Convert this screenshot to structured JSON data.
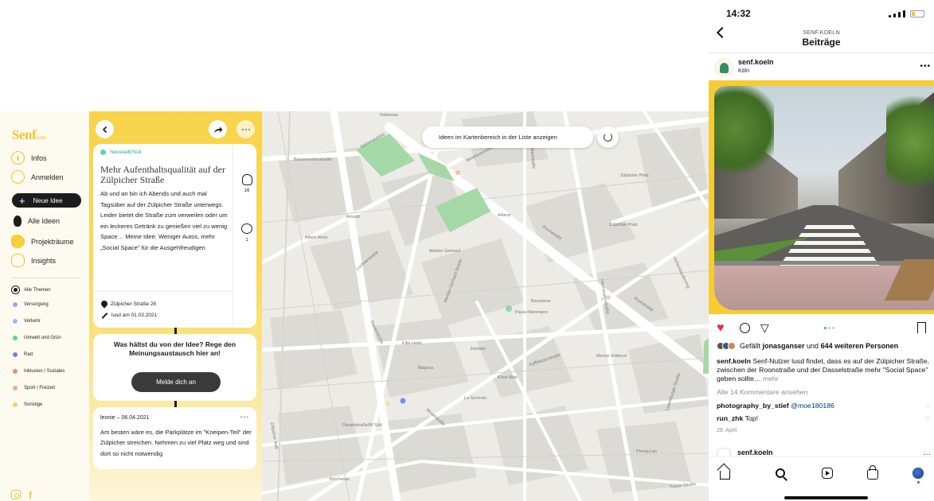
{
  "sidebar": {
    "logo": "Senf",
    "logo_sub": "koeln",
    "nav": [
      {
        "label": "Infos",
        "glyph": "i"
      },
      {
        "label": "Anmelden"
      },
      {
        "label": "Alle Ideen"
      },
      {
        "label": "Projekträume"
      },
      {
        "label": "Insights"
      }
    ],
    "new_idea": "Neue Idee",
    "themes": [
      {
        "label": "Alle Themen"
      },
      {
        "label": "Versorgung",
        "color": "#b69ae6"
      },
      {
        "label": "Verkehr",
        "color": "#8ec6ef"
      },
      {
        "label": "Umwelt und Grün",
        "color": "#63cfab"
      },
      {
        "label": "Rad",
        "color": "#6f85e0"
      },
      {
        "label": "Inklusion / Soziales",
        "color": "#f08a7a"
      },
      {
        "label": "Sport / Freizeit",
        "color": "#f3ae82"
      },
      {
        "label": "Sonstige",
        "color": "#f4d074"
      }
    ],
    "social_f": "f"
  },
  "idea": {
    "district": "Neustadt/Süd",
    "title": "Mehr Aufenthaltsqualität auf der Zülpicher Straße",
    "body": "Ab und an bin ich Abends und auch mal Tagsüber auf der Zülpicher Straße unterwegs. Leider bietet die Straße zum verweilen oder um ein leckeres Getränk zu genießen viel zu wenig Space… Meine Idee: Weniger Autos, mehr „Social Space\" für die Ausgehfreudigen",
    "address": "Zülpicher Straße 26",
    "author_line": "lusd  am 01.03.2021",
    "likes": "16",
    "comments": "1"
  },
  "cta": {
    "text": "Was hältst du von der Idee? Rege den Meinungsaustausch hier an!",
    "button": "Melde dich an"
  },
  "comment": {
    "header": "leonie – 06.04.2021",
    "body": "Am besten wäre es, die Parkplätze im \"Kneipen-Teil\" der Zülpicher streichen. Nehmen zu viel Platz weg und sind dort so nicht notwendig"
  },
  "map": {
    "pill": "Ideen im Kartenbereich in der Liste anzeigen",
    "labels": [
      "Rathenauplatz",
      "Bässeensteinstraße",
      "Beethovenstraße",
      "Engelbertstraße",
      "Zülpicher Platz",
      "Arnoldi",
      "Albert Hertz",
      "Roonstraße",
      "Zülpicher Platz",
      "Meister Gerhard",
      "Lochnerstraße",
      "Meister-Gerhard-Straße",
      "Dasselstraße",
      "Barcelona",
      "Paula Kleinmann",
      "Elite Hotel",
      "Einstein",
      "Magnus",
      "Khun Mae",
      "Kyffhäuserstraße",
      "Merme Kötkerei",
      "La Sorrento",
      "Moselstraße",
      "Dasselstraße/Bf Süd",
      "Zülpicher Wall",
      "Biochemie",
      "Hochstadenstraße",
      "Luxemburger Straße",
      "Hohenstaufenring",
      "Trierer Straße",
      "Phong Lan",
      "Roonstraße",
      "Albenz",
      "Rathenau"
    ]
  },
  "phone": {
    "time": "14:32",
    "nav_sub": "SENF.KOELN",
    "nav_title": "Beiträge",
    "user": "senf.koeln",
    "location": "Köln",
    "liked_prefix": "Gefällt ",
    "liked_user": "jonasganser",
    "liked_mid": " und ",
    "liked_count": "644 weiteren Personen",
    "caption_user": "senf.koeln",
    "caption": " Senf-Nutzer lusd findet, dass es auf der Zülpicher Straße, zwischen der Roonstraße und der Dasselstraße mehr \"Social Space\" geben sollte…",
    "caption_more": " mehr",
    "all_comments": "Alle 14 Kommentare ansehen",
    "comments": [
      {
        "user": "photography_by_stief",
        "text": "@moe180186"
      },
      {
        "user": "run_zhk",
        "text": " Top!"
      }
    ],
    "date": "28. April",
    "next_user": "senf.koeln"
  }
}
